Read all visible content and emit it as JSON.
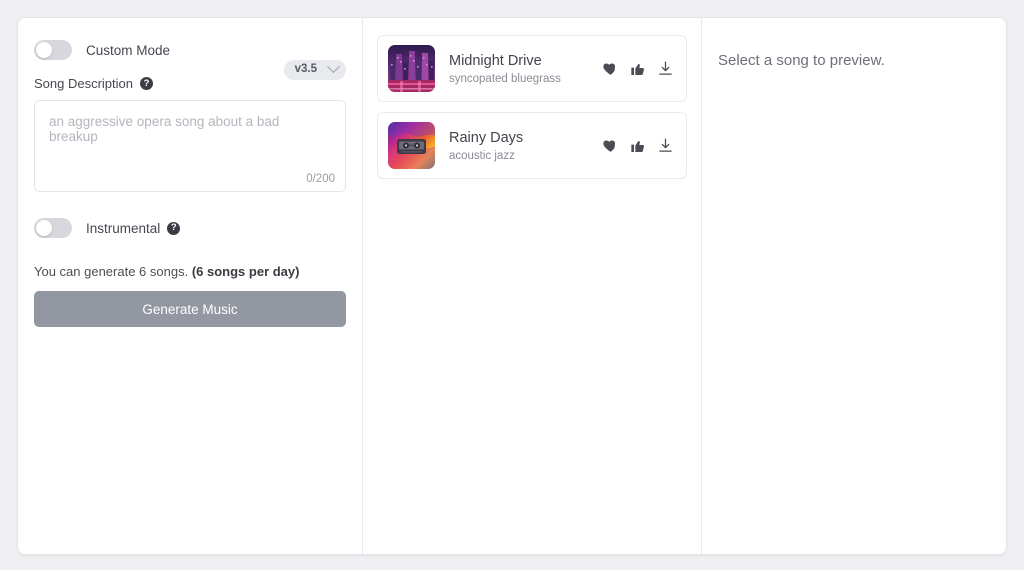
{
  "left_panel": {
    "custom_mode": {
      "label": "Custom Mode",
      "state": "off"
    },
    "version_chip": {
      "label": "v3.5",
      "icon": "chevron-down-icon"
    },
    "song_description": {
      "label": "Song Description",
      "help_icon": "question-mark-icon",
      "help_glyph": "?",
      "value": "",
      "placeholder": "an aggressive opera song about a bad breakup",
      "char_count": "0/200"
    },
    "instrumental": {
      "label": "Instrumental",
      "state": "off",
      "help_icon": "question-mark-icon",
      "help_glyph": "?"
    },
    "quota": {
      "text": "You can generate 6 songs.",
      "emphasis": "(6 songs per day)"
    },
    "generate_button": {
      "label": "Generate Music",
      "color": "#9397a1"
    }
  },
  "song_list": {
    "songs": [
      {
        "title": "Midnight Drive",
        "style": "syncopated bluegrass",
        "artwork": "neon-cityscape-thumbnail",
        "actions": [
          "heart-icon",
          "thumbs-up-icon",
          "download-icon"
        ]
      },
      {
        "title": "Rainy Days",
        "style": "acoustic jazz",
        "artwork": "cassette-tape-thumbnail",
        "actions": [
          "heart-icon",
          "thumbs-up-icon",
          "download-icon"
        ]
      }
    ]
  },
  "preview_panel": {
    "empty_message": "Select a song to preview."
  },
  "colors": {
    "page_background": "#f0f0f2",
    "card_background": "#ffffff",
    "border": "#e6e6ea",
    "text_primary": "#42444b",
    "text_secondary": "#8b8d95",
    "button_disabled": "#9397a1",
    "toggle_track": "#d7d8dd"
  }
}
